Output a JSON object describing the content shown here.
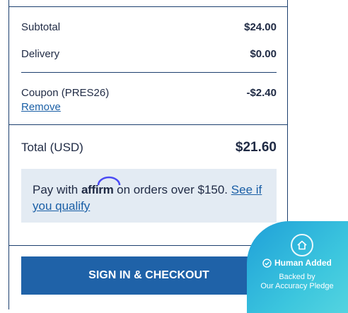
{
  "summary": {
    "subtotal_label": "Subtotal",
    "subtotal_value": "$24.00",
    "delivery_label": "Delivery",
    "delivery_value": "$0.00",
    "coupon_label": "Coupon (PRES26)",
    "coupon_value": "-$2.40",
    "coupon_remove": "Remove",
    "total_label": "Total (USD)",
    "total_value": "$21.60"
  },
  "affirm": {
    "prefix": "Pay with",
    "brand": "affirm",
    "middle": "on orders over $150.",
    "link": "See if you qualify"
  },
  "checkout": {
    "button_label": "SIGN IN & CHECKOUT"
  },
  "badge": {
    "title": "Human Added",
    "line1": "Backed by",
    "line2": "Our Accuracy Pledge",
    "icon": "home-icon"
  },
  "colors": {
    "border": "#1c3f6e",
    "link": "#1a5fa6",
    "button": "#1f62a8",
    "affirm_bg": "#e3ebf3",
    "badge": "#3cc6de"
  }
}
